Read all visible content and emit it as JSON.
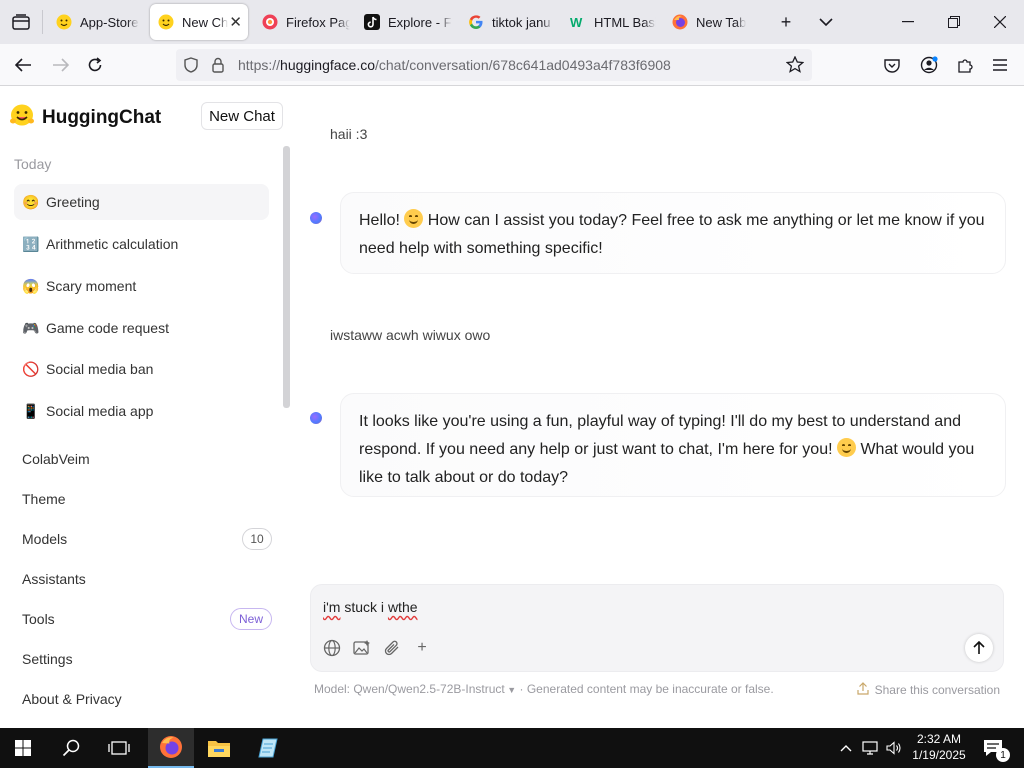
{
  "browser": {
    "tabs": [
      {
        "label": "App-Store",
        "icon": "emoji-hugging-face-icon"
      },
      {
        "label": "New Chat",
        "icon": "emoji-hugging-face-icon",
        "active": true
      },
      {
        "label": "Firefox Page",
        "icon": "firefox-pocket-icon"
      },
      {
        "label": "Explore - Fi",
        "icon": "tiktok-icon"
      },
      {
        "label": "tiktok janu",
        "icon": "google-icon"
      },
      {
        "label": "HTML Basi",
        "icon": "w3schools-icon"
      },
      {
        "label": "New Tab",
        "icon": "firefox-icon"
      }
    ],
    "url_prefix": "https://",
    "url_host": "huggingface.co",
    "url_path": "/chat/conversation/678c641ad0493a4f783f6908"
  },
  "sidebar": {
    "brand": "HuggingChat",
    "new_chat": "New Chat",
    "section": "Today",
    "conversations": [
      {
        "label": "Greeting",
        "emoji": "😊"
      },
      {
        "label": "Arithmetic calculation",
        "emoji": "🔢"
      },
      {
        "label": "Scary moment",
        "emoji": "😱"
      },
      {
        "label": "Game code request",
        "emoji": "🎮"
      },
      {
        "label": "Social media ban",
        "emoji": "🚫"
      },
      {
        "label": "Social media app",
        "emoji": "📱"
      }
    ],
    "menu": {
      "user": "ColabVeim",
      "theme": "Theme",
      "models": "Models",
      "models_count": "10",
      "assistants": "Assistants",
      "tools": "Tools",
      "tools_badge": "New",
      "settings": "Settings",
      "about": "About & Privacy"
    }
  },
  "chat": {
    "messages": [
      {
        "role": "user",
        "text": "haii :3"
      },
      {
        "role": "assistant",
        "before": "Hello! ",
        "after": " How can I assist you today? Feel free to ask me anything or let me know if you need help with something specific!"
      },
      {
        "role": "user",
        "text": "iwstaww acwh wiwux owo"
      },
      {
        "role": "assistant",
        "before": "It looks like you're using a fun, playful way of typing! I'll do my best to understand and respond. If you need any help or just want to chat, I'm here for you! ",
        "after": " What would you like to talk about or do today?"
      }
    ],
    "composer": {
      "w1": "i'm",
      "w2": "stuck",
      "w3": "i",
      "w4": "wthe"
    },
    "footer_model": "Model: Qwen/Qwen2.5-72B-Instruct",
    "footer_note": " · Generated content may be inaccurate or false.",
    "share": "Share this conversation"
  },
  "taskbar": {
    "time": "2:32 AM",
    "date": "1/19/2025",
    "notification_count": "1"
  },
  "colors": {
    "accent": "#7c5fd6",
    "taskbar": "#101010"
  }
}
